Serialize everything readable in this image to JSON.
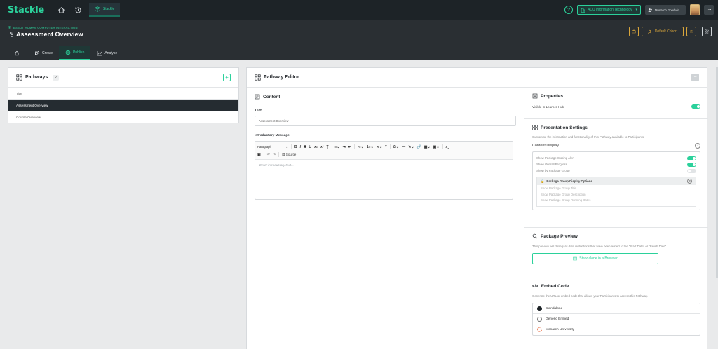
{
  "app": {
    "logo": "Stackle"
  },
  "topbar": {
    "active_tab_label": "Stackle",
    "org_select": "ACU Information Technology",
    "user_name": "Monarch Goodwin"
  },
  "header": {
    "breadcrumb": "BSBOT HUMAN COMPUTER INTERACTION",
    "title": "Assessment Overview",
    "cohort_button": "Default Cohort"
  },
  "nav": {
    "tabs": [
      {
        "label": ""
      },
      {
        "label": "Create"
      },
      {
        "label": "Publish"
      },
      {
        "label": "Analyse"
      }
    ]
  },
  "pathways": {
    "title": "Pathways",
    "count": "2",
    "column_header": "Title",
    "items": [
      {
        "label": "Assessment Overview"
      },
      {
        "label": "Course Overview"
      }
    ]
  },
  "editor": {
    "title": "Pathway Editor",
    "content_title": "Content",
    "title_label": "Title",
    "title_value": "Assessment Overview",
    "intro_label": "Introductory Message",
    "paragraph_select": "Paragraph",
    "source_label": "Source",
    "intro_placeholder": "Enter introductory text..."
  },
  "properties": {
    "title": "Properties",
    "visible_label": "Visible in Learner Hub",
    "visible_on": true
  },
  "presentation": {
    "title": "Presentation Settings",
    "description": "Customise the information and functionality of this Pathway available to Participants.",
    "content_display_label": "Content Display",
    "options": [
      {
        "label": "Show Package Closing Alert",
        "on": true
      },
      {
        "label": "Show Overall Progress",
        "on": true
      },
      {
        "label": "Show by Package Group",
        "on": false
      }
    ],
    "group_title": "Package Group Display Options",
    "group_options": [
      "Show Package Group Title",
      "Show Package Group Description",
      "Show Package Group Running Dates"
    ]
  },
  "preview": {
    "title": "Package Preview",
    "description": "This preview will disregard date restrictions that have been added to the \"Start Date\" or \"Finish Date\"",
    "button": "Standalone in a Browser"
  },
  "embed": {
    "title": "Embed Code",
    "description": "Generate the URL or embed code that allows your Participants to access this Pathway.",
    "items": [
      {
        "label": "Standalone",
        "color": "#1d2327"
      },
      {
        "label": "Generic Embed",
        "color": "#ffffff"
      },
      {
        "label": "Monarch University",
        "color": "#e8663a"
      }
    ]
  },
  "colors": {
    "accent": "#2bd19b",
    "gold": "#d9a63b",
    "dark": "#1d2327"
  }
}
